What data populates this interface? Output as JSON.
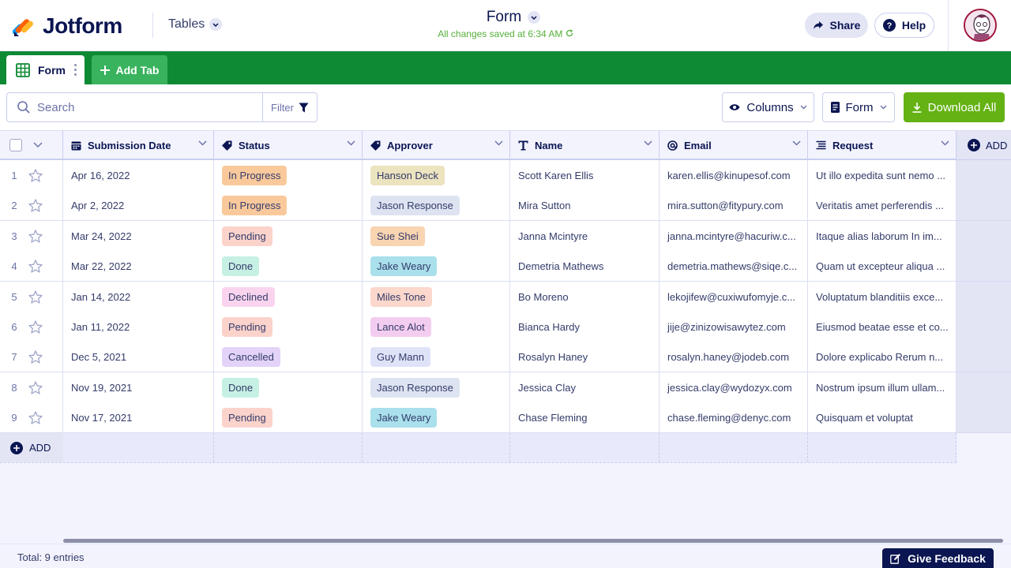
{
  "header": {
    "brand": "Jotform",
    "tables_label": "Tables",
    "form_title": "Form",
    "save_status": "All changes saved at 6:34 AM",
    "share_label": "Share",
    "help_label": "Help"
  },
  "tabs": {
    "form_tab": "Form",
    "add_tab": "Add Tab"
  },
  "toolbar": {
    "search_placeholder": "Search",
    "filter_label": "Filter",
    "columns_label": "Columns",
    "form_label": "Form",
    "download_label": "Download All"
  },
  "columns": {
    "submission_date": "Submission Date",
    "status": "Status",
    "approver": "Approver",
    "name": "Name",
    "email": "Email",
    "request": "Request",
    "add": "ADD"
  },
  "rows": [
    {
      "num": "1",
      "date": "Apr 16, 2022",
      "status": "In Progress",
      "approver": "Hanson Deck",
      "name": "Scott Karen Ellis",
      "email": "karen.ellis@kinupesof.com",
      "request": "Ut illo expedita sunt nemo ..."
    },
    {
      "num": "2",
      "date": "Apr 2, 2022",
      "status": "In Progress",
      "approver": "Jason Response",
      "name": "Mira Sutton",
      "email": "mira.sutton@fitypury.com",
      "request": "Veritatis amet perferendis ..."
    },
    {
      "num": "3",
      "date": "Mar 24, 2022",
      "status": "Pending",
      "approver": "Sue Shei",
      "name": "Janna Mcintyre",
      "email": "janna.mcintyre@hacuriw.c...",
      "request": "Itaque alias laborum In im..."
    },
    {
      "num": "4",
      "date": "Mar 22, 2022",
      "status": "Done",
      "approver": "Jake Weary",
      "name": "Demetria Mathews",
      "email": "demetria.mathews@siqe.c...",
      "request": "Quam ut excepteur aliqua ..."
    },
    {
      "num": "5",
      "date": "Jan 14, 2022",
      "status": "Declined",
      "approver": "Miles Tone",
      "name": "Bo Moreno",
      "email": "lekojifew@cuxiwufomyje.c...",
      "request": "Voluptatum blanditiis exce..."
    },
    {
      "num": "6",
      "date": "Jan 11, 2022",
      "status": "Pending",
      "approver": "Lance Alot",
      "name": "Bianca Hardy",
      "email": "jije@zinizowisawytez.com",
      "request": "Eiusmod beatae esse et co..."
    },
    {
      "num": "7",
      "date": "Dec 5, 2021",
      "status": "Cancelled",
      "approver": "Guy Mann",
      "name": "Rosalyn Haney",
      "email": "rosalyn.haney@jodeb.com",
      "request": "Dolore explicabo Rerum n..."
    },
    {
      "num": "8",
      "date": "Nov 19, 2021",
      "status": "Done",
      "approver": "Jason Response",
      "name": "Jessica Clay",
      "email": "jessica.clay@wydozyx.com",
      "request": "Nostrum ipsum illum ullam..."
    },
    {
      "num": "9",
      "date": "Nov 17, 2021",
      "status": "Pending",
      "approver": "Jake Weary",
      "name": "Chase Fleming",
      "email": "chase.fleming@denyc.com",
      "request": "Quisquam et voluptat"
    }
  ],
  "status_colors": {
    "In Progress": "#f9c99c",
    "Pending": "#fbd3cb",
    "Done": "#c7f0e4",
    "Declined": "#fad4ef",
    "Cancelled": "#e3d3f8"
  },
  "approver_colors": {
    "Hanson Deck": "#ece3bf",
    "Jason Response": "#dde3f1",
    "Sue Shei": "#f9d4b1",
    "Jake Weary": "#a9e0ec",
    "Miles Tone": "#fbd7cc",
    "Lance Alot": "#f3cdf0",
    "Guy Mann": "#dfe3f8"
  },
  "add_row_label": "ADD",
  "footer": {
    "total": "Total: 9 entries",
    "feedback": "Give Feedback"
  }
}
